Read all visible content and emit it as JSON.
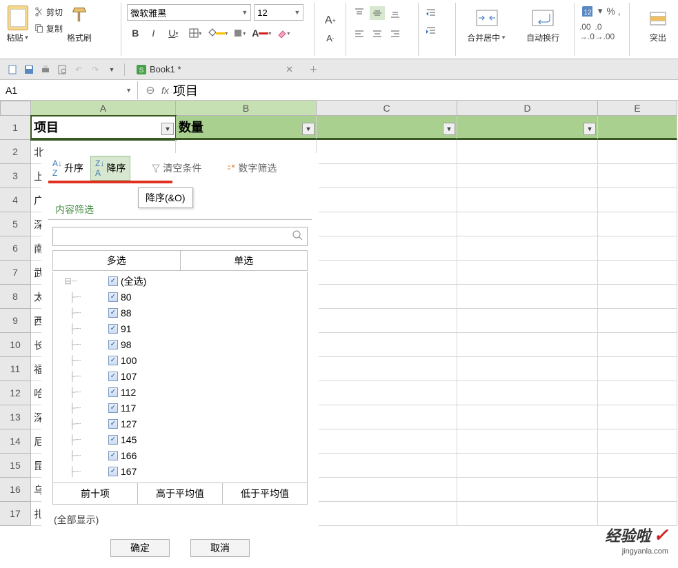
{
  "ribbon": {
    "paste": "粘贴",
    "cut": "剪切",
    "copy": "复制",
    "formatPainter": "格式刷",
    "fontName": "微软雅黑",
    "fontSize": "12",
    "bold": "B",
    "italic": "I",
    "underline": "U",
    "mergeCenter": "合并居中",
    "wrapText": "自动换行",
    "numberFmt": "%  ,",
    "highlight": "突出"
  },
  "qat": {
    "tabName": "Book1 *"
  },
  "formula": {
    "nameBox": "A1",
    "fx": "fx",
    "value": "项目"
  },
  "columns": {
    "A": "A",
    "B": "B",
    "C": "C",
    "D": "D",
    "E": "E"
  },
  "headerRow": {
    "A": "项目",
    "B": "数量"
  },
  "rowData": [
    "北",
    "上",
    "广",
    "深",
    "南",
    "武",
    "太",
    "西",
    "长",
    "福",
    "哈",
    "深",
    "尼",
    "昆",
    "乌",
    "扎"
  ],
  "filter": {
    "asc": "升序",
    "desc": "降序",
    "clearCond": "清空条件",
    "numFilter": "数字筛选",
    "tooltip": "降序(&O)",
    "tabContent": "内容筛选",
    "multi": "多选",
    "single": "单选",
    "selectAll": "(全选)",
    "items": [
      "80",
      "88",
      "91",
      "98",
      "100",
      "107",
      "112",
      "117",
      "127",
      "145",
      "166",
      "167"
    ],
    "topTen": "前十项",
    "aboveAvg": "高于平均值",
    "belowAvg": "低于平均值",
    "showAll": "(全部显示)",
    "ok": "确定",
    "cancel": "取消"
  },
  "watermark": {
    "main": "经验啦",
    "check": "✓",
    "sub": "jingyanla.com"
  }
}
